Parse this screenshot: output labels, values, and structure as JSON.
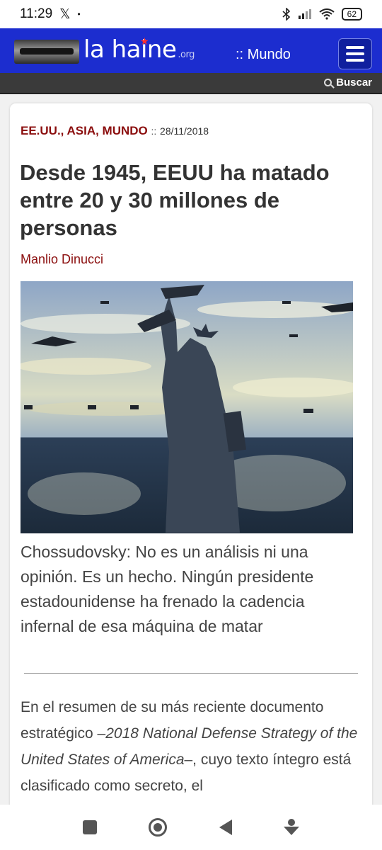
{
  "status_bar": {
    "time": "11:29",
    "x_glyph": "𝕏",
    "dot": "•",
    "battery": "62"
  },
  "header": {
    "logo_text": "la haine",
    "logo_org": ".org",
    "section": ":: Mundo",
    "search_label": "Buscar"
  },
  "article": {
    "categories": "EE.UU., ASIA, MUNDO",
    "separator": "::",
    "date": "28/11/2018",
    "title": "Desde 1945, EEUU ha matado entre 20 y 30 millones de personas",
    "author": "Manlio Dinucci",
    "summary": "Chossudovsky: No es un análisis ni una opinión. Es un hecho. Ningún presidente estadounidense ha frenado la cadencia infernal de esa máquina de matar",
    "body_start": "En el resumen de su más reciente documento estratégico –",
    "body_italic": "2018 National Defense Strategy of the United States of America",
    "body_end": "–, cuyo texto íntegro está clasificado como secreto, el"
  },
  "colors": {
    "header_blue": "#1c2dcf",
    "category_red": "#8b0e0e"
  },
  "icons": [
    "x-icon",
    "bluetooth-icon",
    "signal-icon",
    "wifi-icon",
    "battery-icon",
    "menu-icon",
    "search-icon",
    "statue-of-liberty-image",
    "nav-recents-icon",
    "nav-home-icon",
    "nav-back-icon",
    "nav-assistant-icon"
  ]
}
